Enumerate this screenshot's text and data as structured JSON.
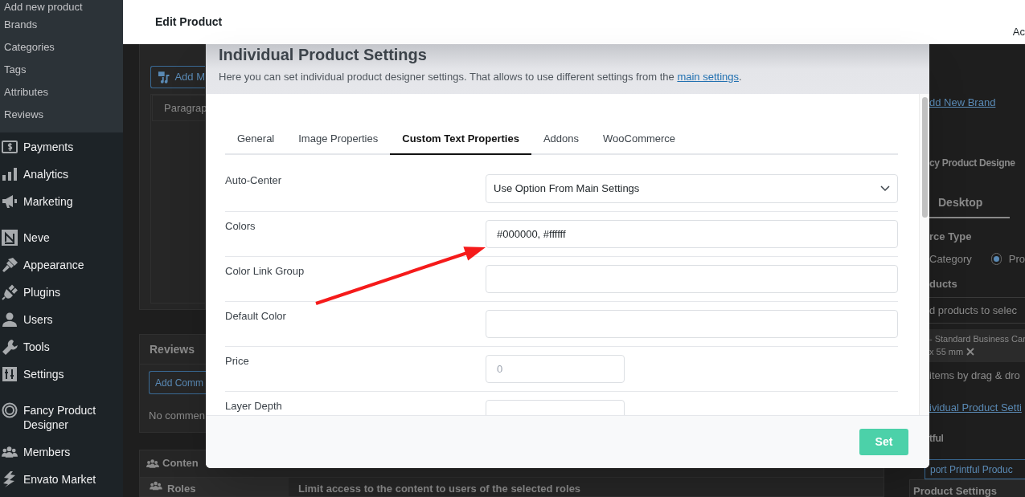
{
  "sidebar": {
    "submenu": [
      "Add new product",
      "Brands",
      "Categories",
      "Tags",
      "Attributes",
      "Reviews"
    ],
    "menu_groups": [
      [
        "Payments",
        "Analytics",
        "Marketing"
      ],
      [
        "Neve",
        "Appearance",
        "Plugins",
        "Users",
        "Tools",
        "Settings"
      ],
      [
        "Fancy Product Designer",
        "Members",
        "Envato Market"
      ]
    ]
  },
  "header": {
    "title": "Edit Product",
    "action": "Ac"
  },
  "background": {
    "left": {
      "add_media": "Add M",
      "editor_tab": "Paragrap",
      "reviews_title": "Reviews",
      "add_comment": "Add Comm",
      "no_comments": "No commen",
      "content_title": "Conten",
      "roles_tab": "Roles",
      "roles_hint": "Limit access to the content to users of the selected roles"
    },
    "right": [
      {
        "kind": "link",
        "text": "dd New Brand"
      },
      {
        "kind": "heading",
        "text": "cy Product Designe"
      },
      {
        "kind": "tab",
        "text": "Desktop",
        "selected": true
      },
      {
        "kind": "label",
        "text": "rce Type"
      },
      {
        "kind": "radios",
        "clipped_label": "Category",
        "options": [
          {
            "label": "Pro",
            "selected": true
          }
        ]
      },
      {
        "kind": "label",
        "text": "ducts"
      },
      {
        "kind": "search",
        "placeholder": "d products to selec"
      },
      {
        "kind": "chip",
        "lines": [
          "- Standard Business Car",
          "x 55 mm"
        ]
      },
      {
        "kind": "hint",
        "text": "items by drag & dro"
      },
      {
        "kind": "link",
        "text": "ividual Product Setti"
      },
      {
        "kind": "heading",
        "text": "tful"
      },
      {
        "kind": "button",
        "text": "port Printful Produc"
      }
    ],
    "settings_panel": "Product Settings"
  },
  "modal": {
    "title": "Individual Product Settings",
    "description": "Here you can set individual product designer settings. That allows to use different settings from the ",
    "link": "main settings",
    "description_end": ".",
    "tabs": [
      {
        "label": "General",
        "selected": false
      },
      {
        "label": "Image Properties",
        "selected": false
      },
      {
        "label": "Custom Text Properties",
        "selected": true
      },
      {
        "label": "Addons",
        "selected": false
      },
      {
        "label": "WooCommerce",
        "selected": false
      }
    ],
    "fields": [
      {
        "label": "Auto-Center",
        "kind": "select",
        "value": "Use Option From Main Settings"
      },
      {
        "label": "Colors",
        "kind": "text",
        "value": "#000000, #ffffff"
      },
      {
        "label": "Color Link Group",
        "kind": "text"
      },
      {
        "label": "Default Color",
        "kind": "text"
      },
      {
        "label": "Price",
        "kind": "number",
        "placeholder": "0"
      },
      {
        "label": "Layer Depth",
        "kind": "number"
      }
    ],
    "button": "Set"
  }
}
